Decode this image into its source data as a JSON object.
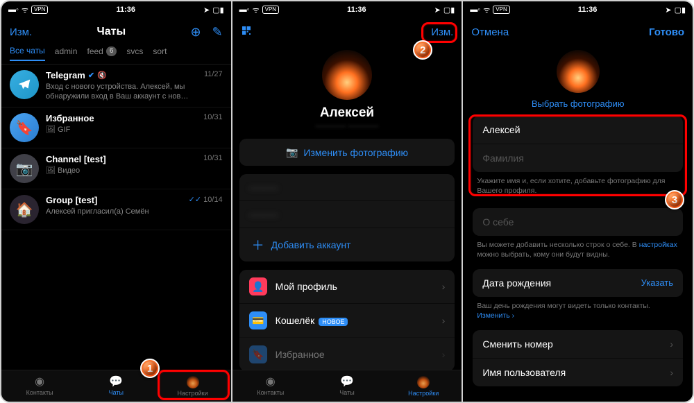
{
  "status": {
    "time": "11:36",
    "vpn": "VPN"
  },
  "s1": {
    "edit": "Изм.",
    "title": "Чаты",
    "tabs": [
      "Все чаты",
      "admin",
      "feed",
      "svcs",
      "sort"
    ],
    "tab_badge": "6",
    "chats": [
      {
        "name": "Telegram",
        "date": "11/27",
        "msg": "Вход с нового устройства. Алексей, мы обнаружили вход в Ваш аккаунт с нов…",
        "verified": true,
        "muted": true
      },
      {
        "name": "Избранное",
        "date": "10/31",
        "msg": "🖼 GIF"
      },
      {
        "name": "Channel [test]",
        "date": "10/31",
        "msg": "🖼 Видео"
      },
      {
        "name": "Group [test]",
        "date": "10/14",
        "msg": "Алексей пригласил(а) Семён",
        "read": true
      }
    ],
    "tabbar": [
      "Контакты",
      "Чаты",
      "Настройки"
    ]
  },
  "s2": {
    "edit": "Изм.",
    "name": "Алексей",
    "change_photo": "Изменить фотографию",
    "add_account": "Добавить аккаунт",
    "rows": {
      "profile": "Мой профиль",
      "wallet": "Кошелёк",
      "wallet_new": "новое",
      "fav": "Избранное"
    },
    "tabbar": [
      "Контакты",
      "Чаты",
      "Настройки"
    ]
  },
  "s3": {
    "cancel": "Отмена",
    "done": "Готово",
    "choose": "Выбрать фотографию",
    "first_name": "Алексей",
    "last_name": "Фамилия",
    "caption1": "Укажите имя и, если хотите, добавьте фотографию для Вашего профиля.",
    "about": "О себе",
    "caption2_a": "Вы можете добавить несколько строк о себе. В ",
    "caption2_link": "настройках",
    "caption2_b": " можно выбрать, кому они будут видны.",
    "bday": "Дата рождения",
    "bday_action": "Указать",
    "caption3_a": "Ваш день рождения могут видеть только контакты. ",
    "caption3_link": "Изменить ›",
    "change_number": "Сменить номер",
    "username": "Имя пользователя"
  }
}
